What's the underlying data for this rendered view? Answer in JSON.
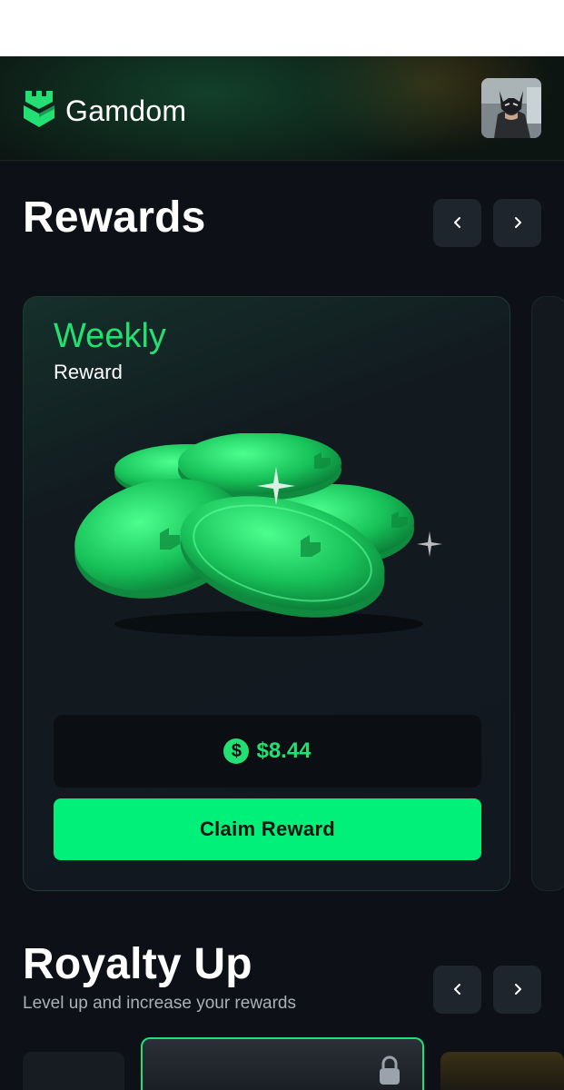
{
  "header": {
    "brand": "Gamdom",
    "logo_icon": "gamdom-castle-icon",
    "avatar_icon": "user-avatar"
  },
  "rewards": {
    "title": "Rewards",
    "prev_icon": "chevron-left-icon",
    "next_icon": "chevron-right-icon",
    "card": {
      "title": "Weekly",
      "subtitle": "Reward",
      "amount_icon": "dollar-coin-icon",
      "amount_symbol": "$",
      "amount": "$8.44",
      "claim_label": "Claim Reward"
    }
  },
  "royalty": {
    "title": "Royalty Up",
    "subtitle": "Level up and increase your rewards",
    "prev_icon": "chevron-left-icon",
    "next_icon": "chevron-right-icon",
    "lock_icon": "lock-icon"
  },
  "colors": {
    "accent": "#00f07a",
    "accent_text": "#23e071",
    "background": "#0d1117"
  }
}
